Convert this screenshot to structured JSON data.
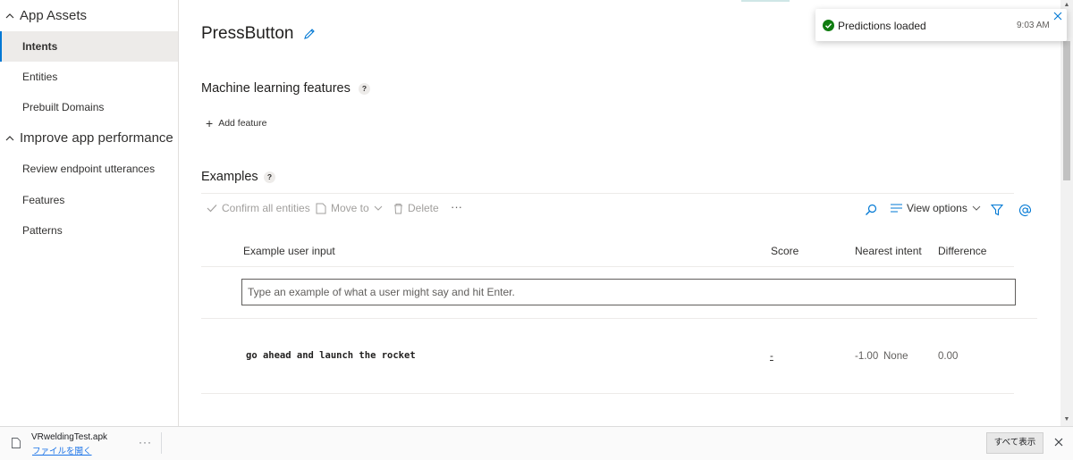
{
  "sidebar": {
    "app_assets": "App Assets",
    "improve": "Improve app performance",
    "items": [
      {
        "label": "Intents"
      },
      {
        "label": "Entities"
      },
      {
        "label": "Prebuilt Domains"
      },
      {
        "label": "Review endpoint utterances"
      },
      {
        "label": "Features"
      },
      {
        "label": "Patterns"
      }
    ]
  },
  "page": {
    "title": "PressButton",
    "ml_features": "Machine learning features",
    "help": "?",
    "add_feature": "Add feature",
    "examples": "Examples"
  },
  "toolbar": {
    "confirm_all": "Confirm all entities",
    "move_to": "Move to",
    "delete": "Delete",
    "more": "···",
    "view_options": "View options"
  },
  "table": {
    "columns": [
      "Example user input",
      "Score",
      "Nearest intent",
      "Difference"
    ],
    "input_placeholder": "Type an example of what a user might say and hit Enter.",
    "rows": [
      {
        "text": "go ahead and launch the rocket",
        "score": "-",
        "nearest_score": "-1.00",
        "nearest_intent": "None",
        "difference": "0.00"
      }
    ]
  },
  "toast": {
    "message": "Predictions loaded",
    "time": "9:03 AM"
  },
  "download_bar": {
    "file_name": "VRweldingTest.apk",
    "open_label": "ファイルを開く",
    "more": "···",
    "show_all": "すべて表示"
  },
  "colors": {
    "accent": "#0078d4",
    "success": "#107c10",
    "active_bg": "#edebe9"
  }
}
